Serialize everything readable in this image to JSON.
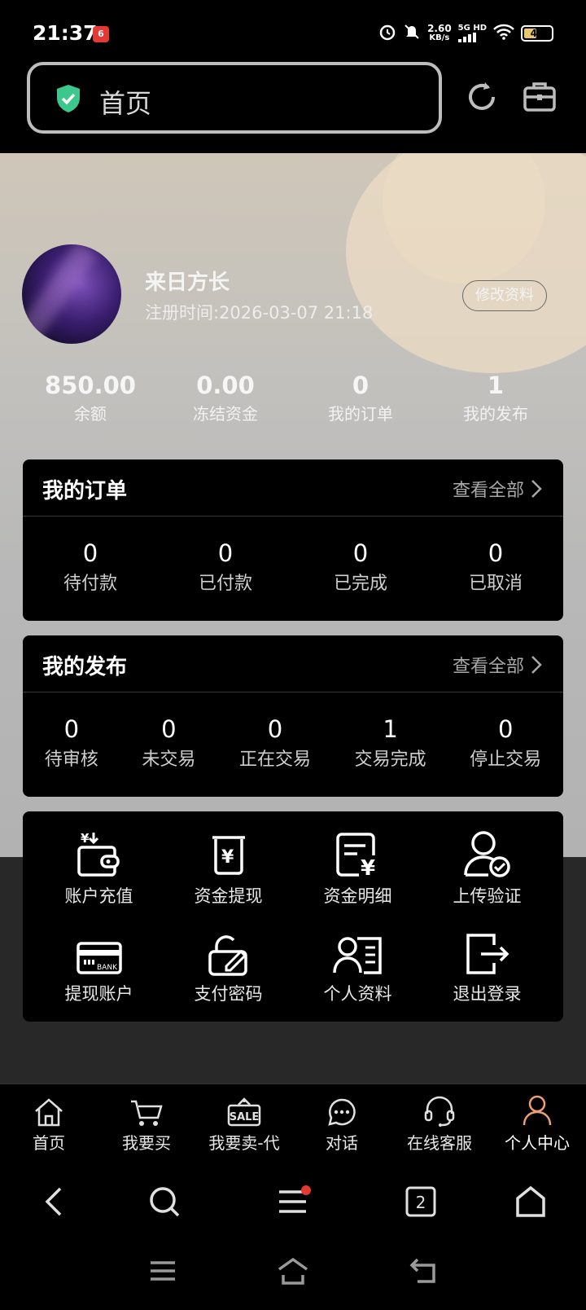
{
  "status_bar": {
    "time": "21:37",
    "app_badge": "6",
    "speed_value": "2.60",
    "speed_unit": "KB/s",
    "net_type": "5G HD",
    "battery_level": "46",
    "battery_percent": 46
  },
  "browser": {
    "address_text": "首页",
    "tab_count": "2"
  },
  "profile": {
    "username": "来日方长",
    "register_time": "注册时间:2026-03-07 21:18",
    "edit_label": "修改资料",
    "stats": [
      {
        "value": "850.00",
        "label": "余额"
      },
      {
        "value": "0.00",
        "label": "冻结资金"
      },
      {
        "value": "0",
        "label": "我的订单"
      },
      {
        "value": "1",
        "label": "我的发布"
      }
    ]
  },
  "orders": {
    "title": "我的订单",
    "more": "查看全部",
    "items": [
      {
        "value": "0",
        "label": "待付款"
      },
      {
        "value": "0",
        "label": "已付款"
      },
      {
        "value": "0",
        "label": "已完成"
      },
      {
        "value": "0",
        "label": "已取消"
      }
    ]
  },
  "publish": {
    "title": "我的发布",
    "more": "查看全部",
    "items": [
      {
        "value": "0",
        "label": "待审核"
      },
      {
        "value": "0",
        "label": "未交易"
      },
      {
        "value": "0",
        "label": "正在交易"
      },
      {
        "value": "1",
        "label": "交易完成"
      },
      {
        "value": "0",
        "label": "停止交易"
      }
    ]
  },
  "tools": [
    {
      "label": "账户充值",
      "icon": "wallet-recharge-icon"
    },
    {
      "label": "资金提现",
      "icon": "withdraw-icon"
    },
    {
      "label": "资金明细",
      "icon": "fund-detail-icon"
    },
    {
      "label": "上传验证",
      "icon": "verify-user-icon"
    },
    {
      "label": "提现账户",
      "icon": "bank-card-icon"
    },
    {
      "label": "支付密码",
      "icon": "lock-edit-icon"
    },
    {
      "label": "个人资料",
      "icon": "profile-card-icon"
    },
    {
      "label": "退出登录",
      "icon": "logout-icon"
    }
  ],
  "bottom_nav": [
    {
      "label": "首页",
      "icon": "home-icon"
    },
    {
      "label": "我要买",
      "icon": "cart-icon"
    },
    {
      "label": "我要卖-代",
      "icon": "sale-tag-icon",
      "sale_text": "SALE"
    },
    {
      "label": "对话",
      "icon": "chat-icon"
    },
    {
      "label": "在线客服",
      "icon": "headset-icon"
    },
    {
      "label": "个人中心",
      "icon": "user-icon",
      "active": true
    }
  ],
  "colors": {
    "accent_user": "#f0a070",
    "shield": "#3cc88c",
    "badge": "#e53935"
  }
}
